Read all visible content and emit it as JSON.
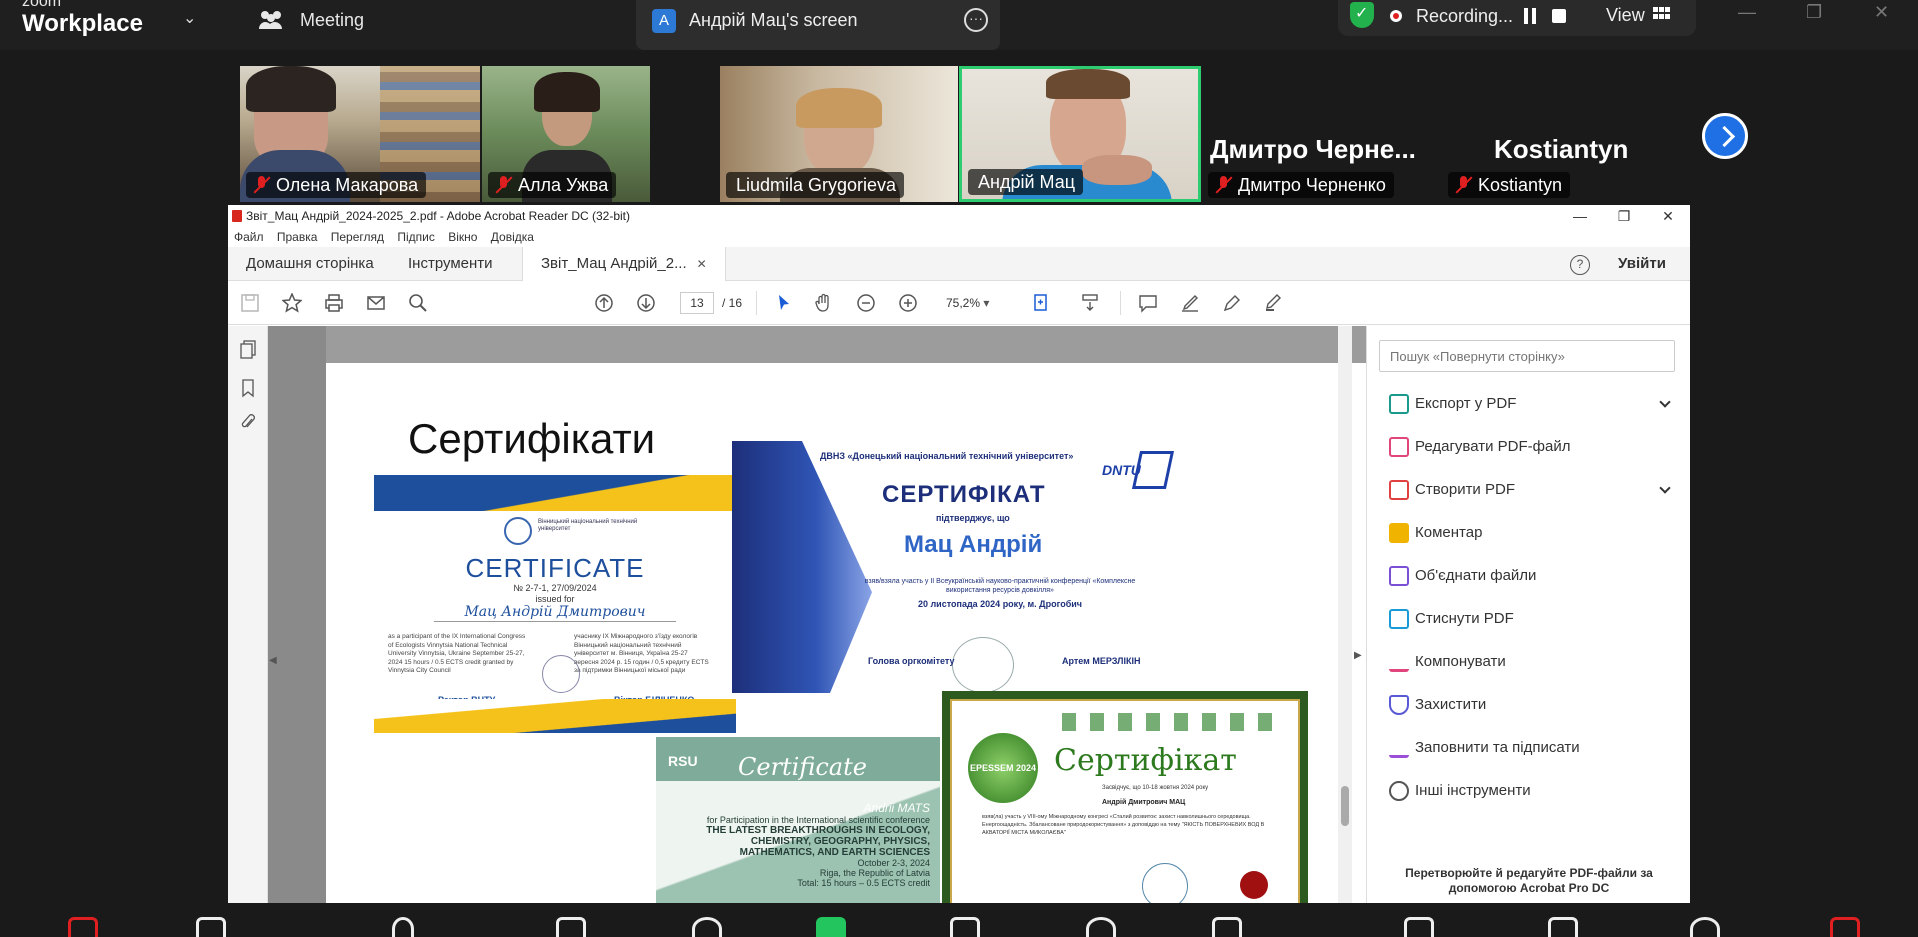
{
  "zoom": {
    "logo_top": "zoom",
    "logo_bottom": "Workplace",
    "meeting_label": "Meeting",
    "screen_tab": {
      "avatar": "A",
      "label": "Андрій Мац's screen"
    },
    "recording": {
      "label": "Recording...",
      "view_label": "View"
    },
    "colors": {
      "accent": "#1f6fe5",
      "rec": "#e02020",
      "shield": "#22b14c",
      "active_border": "#2ecc71"
    }
  },
  "participants": [
    {
      "name": "Олена Макарова",
      "muted": true
    },
    {
      "name": "Алла Ужва",
      "muted": true
    },
    {
      "name": "Liudmila Grygorieva",
      "muted": false
    },
    {
      "name": "Андрій Мац",
      "muted": false,
      "active": true
    },
    {
      "name": "Дмитро Черненко",
      "muted": true,
      "display": "Дмитро  Черне..."
    },
    {
      "name": "Kostiantyn",
      "muted": true,
      "display": "Kostiantyn"
    }
  ],
  "acrobat": {
    "title": "Звіт_Мац Андрій_2024-2025_2.pdf - Adobe Acrobat Reader DC (32-bit)",
    "menu": [
      "Файл",
      "Правка",
      "Перегляд",
      "Підпис",
      "Вікно",
      "Довідка"
    ],
    "tabs": {
      "home": "Домашня сторінка",
      "tools": "Інструменти",
      "doc": "Звіт_Мац Андрій_2..."
    },
    "sign_in": "Увійти",
    "help": "?",
    "toolbar": {
      "page_current": "13",
      "page_total": "/  16",
      "zoom": "75,2%"
    },
    "search_placeholder": "Пошук «Повернути сторінку»",
    "tools": [
      {
        "label": "Експорт у PDF",
        "icon": "export-pdf-icon",
        "color": "#1a9a8a",
        "expand": true
      },
      {
        "label": "Редагувати PDF-файл",
        "icon": "edit-pdf-icon",
        "color": "#e0457b",
        "expand": false
      },
      {
        "label": "Створити PDF",
        "icon": "create-pdf-icon",
        "color": "#e04040",
        "expand": true
      },
      {
        "label": "Коментар",
        "icon": "comment-icon",
        "color": "#f0b400",
        "expand": false
      },
      {
        "label": "Об'єднати файли",
        "icon": "combine-files-icon",
        "color": "#7a4fd6",
        "expand": false
      },
      {
        "label": "Стиснути PDF",
        "icon": "compress-pdf-icon",
        "color": "#1a9ad6",
        "expand": false
      },
      {
        "label": "Компонувати",
        "icon": "organize-icon",
        "color": "#e0457b",
        "expand": false
      },
      {
        "label": "Захистити",
        "icon": "protect-icon",
        "color": "#5a5ad6",
        "expand": false
      },
      {
        "label": "Заповнити та підписати",
        "icon": "fill-sign-icon",
        "color": "#9a4fd6",
        "expand": false
      },
      {
        "label": "Інші інструменти",
        "icon": "more-tools-icon",
        "color": "#555555",
        "expand": false
      }
    ],
    "promo": "Перетворюйте й редагуйте PDF-файли за допомогою Acrobat Pro DC"
  },
  "document": {
    "slide_title": "Сертифікати",
    "cert_vntu": {
      "org": "Вінницький національний технічний університет",
      "heading": "CERTIFICATE",
      "number": "№ 2-7-1, 27/09/2024",
      "issued": "issued for",
      "name": "Мац Андрій Дмитрович",
      "text_en": "as a participant of the IX International Congress of Ecologists Vinnytsia National Technical University Vinnytsia, Ukraine September 25-27, 2024 15 hours / 0.5 ECTS credit granted by Vinnytsia City Council",
      "text_ua": "учаснику IX Міжнародного з'їзду екологів Вінницький національний технічний університет м. Вінниця, Україна 25-27 вересня 2024 р. 15 годин / 0,5 кредиту ECTS за підтримки Вінницької міської ради",
      "rector": "Ректор ВНТУ",
      "signer": "Віктор БІЛІЧЕНКО"
    },
    "cert_dntu": {
      "org": "ДВНЗ «Донецький національний технічний університет»",
      "logo": "DNTU",
      "heading": "СЕРТИФІКАТ",
      "confirms": "підтверджує, що",
      "name": "Мац Андрій",
      "text": "взяв/взяла участь у ІІ Всеукраїнській науково-практичній конференції «Комплексне використання ресурсів довкілля»",
      "date": "20 листопада 2024 року, м. Дрогобич",
      "chair": "Голова оргкомітету",
      "signer": "Артем МЕРЗЛІКІН"
    },
    "cert_green": {
      "logo": "RSU",
      "heading": "Certificate",
      "name": "Andrii MATS",
      "line1": "for Participation in the International scientific conference",
      "line2": "THE LATEST BREAKTHROUGHS IN ECOLOGY, CHEMISTRY, GEOGRAPHY, PHYSICS, MATHEMATICS, AND EARTH SCIENCES",
      "date": "October 2-3, 2024",
      "place": "Riga, the Republic of Latvia",
      "total": "Total: 15 hours – 0.5 ECTS credit"
    },
    "cert_epessem": {
      "logo": "EPESSEM 2024",
      "heading": "Сертифікат",
      "small": "Засвідчує, що 10-18 жовтня 2024 року",
      "name": "Андрій Дмитрович МАЦ",
      "text": "взяв(ла) участь у VIII-ому Міжнародному конгресі «Сталий розвиток: захист навколишнього середовища. Енергоощадність. Збалансоване природокористування» з доповіддю на тему \"ЯКІСТЬ ПОВЕРХНЕВИХ ВОД В АКВАТОРІЇ МІСТА МИКОЛАЄВА\""
    }
  }
}
